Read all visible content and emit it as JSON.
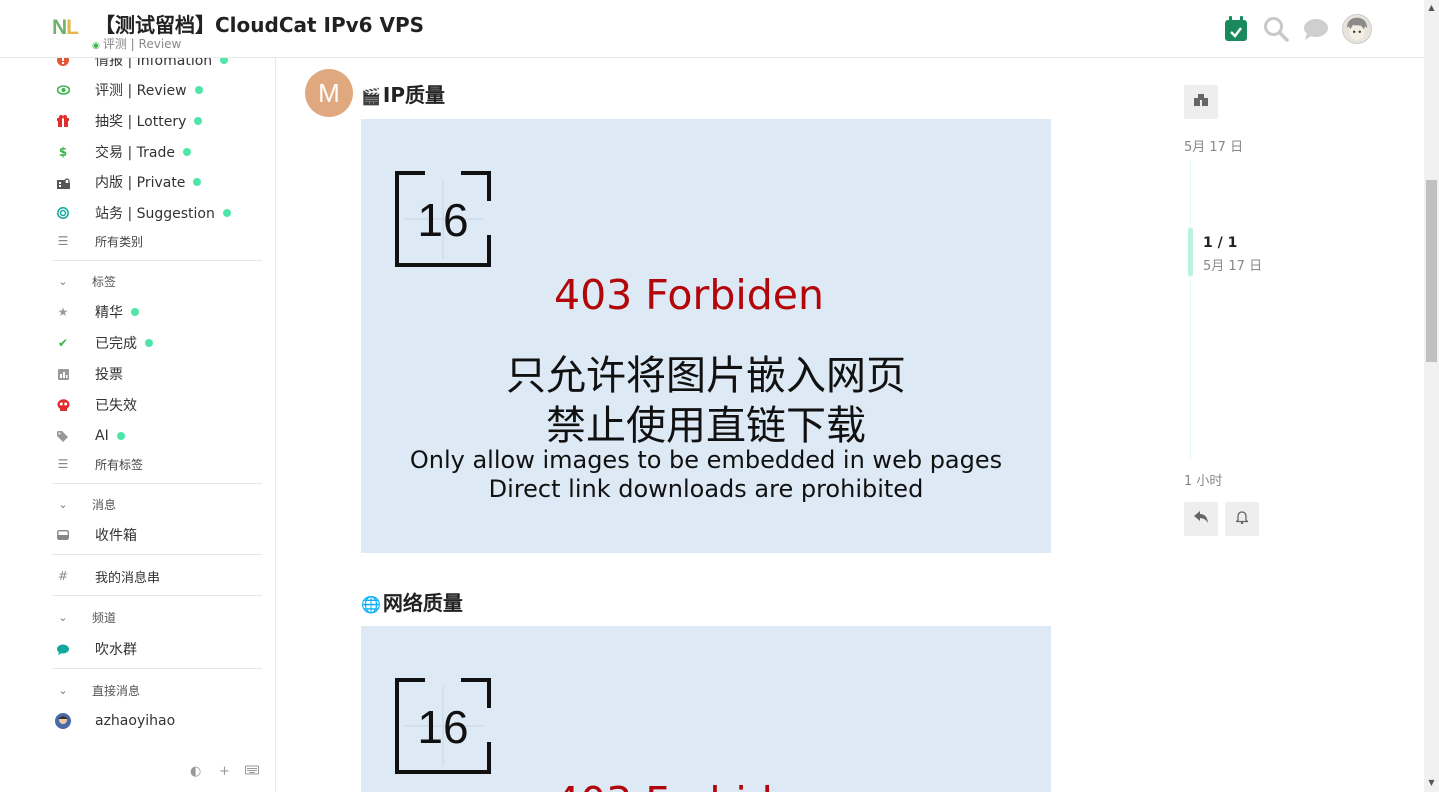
{
  "header": {
    "logo_n": "N",
    "logo_l": "L",
    "title": "【测试留档】CloudCat IPv6 VPS",
    "category": "评测 | Review",
    "icons": [
      "calendar-check-icon",
      "search-icon",
      "chat-icon",
      "user-avatar"
    ]
  },
  "sidebar": {
    "categories": [
      {
        "label": "情报 | Infomation",
        "icon": "info-icon",
        "color": "#e45735",
        "dot": true
      },
      {
        "label": "评测 | Review",
        "icon": "eye-icon",
        "color": "#3ab54a",
        "dot": true
      },
      {
        "label": "抽奖 | Lottery",
        "icon": "gift-icon",
        "color": "#e02d2d",
        "dot": true
      },
      {
        "label": "交易 | Trade",
        "icon": "dollar-icon",
        "color": "#3ab54a",
        "dot": true
      },
      {
        "label": "内版 | Private",
        "icon": "building-lock-icon",
        "color": "#555555",
        "dot": true
      },
      {
        "label": "站务 | Suggestion",
        "icon": "target-icon",
        "color": "#12a89d",
        "dot": true
      }
    ],
    "all_categories": "所有类别",
    "tags_header": "标签",
    "tags": [
      {
        "label": "精华",
        "icon": "star-icon",
        "dot": true
      },
      {
        "label": "已完成",
        "icon": "check-icon",
        "dot": true
      },
      {
        "label": "投票",
        "icon": "chart-icon",
        "dot": false
      },
      {
        "label": "已失效",
        "icon": "skull-icon",
        "dot": false
      },
      {
        "label": "AI",
        "icon": "tag-icon",
        "dot": true
      }
    ],
    "all_tags": "所有标签",
    "messages_header": "消息",
    "inbox": "收件箱",
    "my_threads": "我的消息串",
    "channels_header": "频道",
    "channel": "吹水群",
    "dm_header": "直接消息",
    "dm_user": "azhaoyihao",
    "footer_icons": [
      "theme-toggle-icon",
      "plus-icon",
      "keyboard-icon"
    ]
  },
  "post": {
    "avatar_letter": "M",
    "avatar_color": "#e0a87e",
    "section1_emoji": "🎬",
    "section1_title": "IP质量",
    "section2_emoji": "🌐",
    "section2_title": "网络质量",
    "image": {
      "badge_number": "16",
      "error_title": "403 Forbiden",
      "cn_line1": "只允许将图片嵌入网页",
      "cn_line2": "禁止使用直链下载",
      "en_line1": "Only allow images to be embedded in web pages",
      "en_line2": "Direct link downloads are prohibited",
      "accent": "#b3060a"
    }
  },
  "timeline": {
    "start_date": "5月 17 日",
    "position": "1 / 1",
    "position_date": "5月 17 日",
    "last_activity": "1 小时",
    "buttons": [
      "summary-icon",
      "reply-icon",
      "bell-icon"
    ]
  }
}
